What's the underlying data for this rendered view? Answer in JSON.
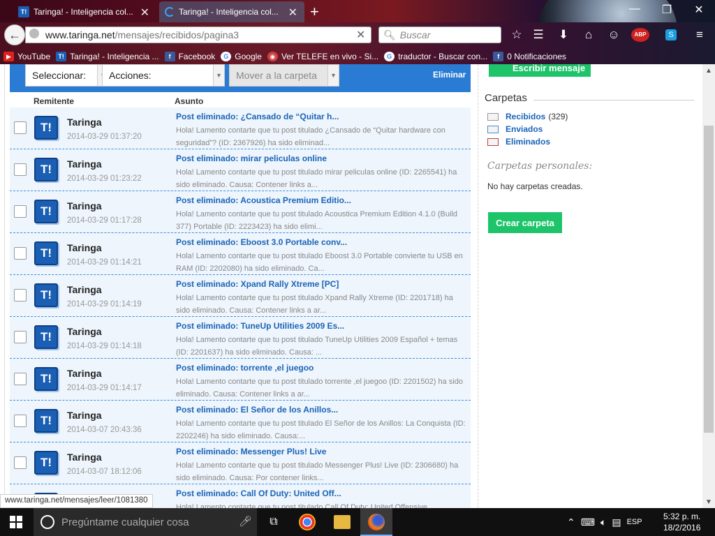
{
  "browser": {
    "tabs": [
      {
        "title": "Taringa! - Inteligencia col...",
        "favicon": "T!"
      },
      {
        "title": "Taringa! - Inteligencia col...",
        "favicon": "loading"
      }
    ],
    "url_domain": "www.taringa.net",
    "url_path": "/mensajes/recibidos/pagina3",
    "search_placeholder": "Buscar",
    "addon_label": "ABP",
    "bookmarks": [
      {
        "label": "YouTube",
        "icon": "youtube-icon",
        "color": "#e02020"
      },
      {
        "label": "Taringa! - Inteligencia ...",
        "icon": "T!",
        "color": "#1b5fb5"
      },
      {
        "label": "Facebook",
        "icon": "f",
        "color": "#3b5998"
      },
      {
        "label": "Google",
        "icon": "G",
        "color": "#ffffff"
      },
      {
        "label": "Ver TELEFE en vivo - Si...",
        "icon": "eye",
        "color": "#d04040"
      },
      {
        "label": "traductor - Buscar con...",
        "icon": "G",
        "color": "#ffffff"
      },
      {
        "label": "0 Notificaciones",
        "icon": "f",
        "color": "#3b5998"
      }
    ]
  },
  "toolbar": {
    "select_label": "Seleccionar:",
    "actions_label": "Acciones:",
    "move_label": "Mover a la carpeta",
    "delete_label": "Eliminar"
  },
  "columns": {
    "sender": "Remitente",
    "subject": "Asunto"
  },
  "messages": [
    {
      "sender": "Taringa",
      "date": "2014-03-29 01:37:20",
      "subject": "Post eliminado: ¿Cansado de “Quitar h...",
      "preview": "Hola! Lamento contarte que tu post titulado ¿Cansado de “Quitar hardware con seguridad”? (ID: 2367926) ha sido eliminad..."
    },
    {
      "sender": "Taringa",
      "date": "2014-03-29 01:23:22",
      "subject": "Post eliminado: mirar peliculas online",
      "preview": "Hola! Lamento contarte que tu post titulado mirar peliculas online (ID: 2265541) ha sido eliminado. Causa: Contener links a..."
    },
    {
      "sender": "Taringa",
      "date": "2014-03-29 01:17:28",
      "subject": "Post eliminado: Acoustica Premium Editio...",
      "preview": "Hola! Lamento contarte que tu post titulado Acoustica Premium Edition 4.1.0 (Build 377) Portable (ID: 2223423) ha sido elimi..."
    },
    {
      "sender": "Taringa",
      "date": "2014-03-29 01:14:21",
      "subject": "Post eliminado: Eboost 3.0 Portable conv...",
      "preview": "Hola! Lamento contarte que tu post titulado Eboost 3.0 Portable convierte tu USB en RAM (ID: 2202080) ha sido eliminado. Ca..."
    },
    {
      "sender": "Taringa",
      "date": "2014-03-29 01:14:19",
      "subject": "Post eliminado: Xpand Rally Xtreme [PC]",
      "preview": "Hola! Lamento contarte que tu post titulado Xpand Rally Xtreme (ID: 2201718) ha sido eliminado. Causa: Contener links a ar..."
    },
    {
      "sender": "Taringa",
      "date": "2014-03-29 01:14:18",
      "subject": "Post eliminado: TuneUp Utilities 2009 Es...",
      "preview": "Hola! Lamento contarte que tu post titulado TuneUp Utilities 2009 Español + temas (ID: 2201637) ha sido eliminado. Causa: ..."
    },
    {
      "sender": "Taringa",
      "date": "2014-03-29 01:14:17",
      "subject": "Post eliminado: torrente ,el juegoo",
      "preview": "Hola! Lamento contarte que tu post titulado torrente ,el juegoo (ID: 2201502) ha sido eliminado. Causa: Contener links a ar..."
    },
    {
      "sender": "Taringa",
      "date": "2014-03-07 20:43:36",
      "subject": "Post eliminado: El Señor de los Anillos...",
      "preview": "Hola! Lamento contarte que tu post titulado El Señor de los Anillos: La Conquista (ID: 2202246) ha sido eliminado. Causa:..."
    },
    {
      "sender": "Taringa",
      "date": "2014-03-07 18:12:06",
      "subject": "Post eliminado: Messenger Plus! Live",
      "preview": "Hola! Lamento contarte que tu post titulado Messenger Plus! Live (ID: 2306680) ha sido eliminado. Causa: Por contener links..."
    },
    {
      "sender": "Taringa",
      "date": "",
      "subject": "Post eliminado: Call Of Duty: United Off...",
      "preview": "Hola! Lamento contarte que tu post titulado Call Of Duty: United Offensive"
    }
  ],
  "sidebar": {
    "write_label": "Escribir mensaje",
    "folders_title": "Carpetas",
    "folders": [
      {
        "label": "Recibidos",
        "count": "(329)"
      },
      {
        "label": "Enviados",
        "count": ""
      },
      {
        "label": "Eliminados",
        "count": ""
      }
    ],
    "personal_title": "Carpetas personales:",
    "empty_text": "No hay carpetas creadas.",
    "create_label": "Crear carpeta"
  },
  "status_url": "www.taringa.net/mensajes/leer/1081380",
  "taskbar": {
    "search_placeholder": "Pregúntame cualquier cosa",
    "lang": "ESP",
    "time": "5:32 p. m.",
    "date": "18/2/2016"
  },
  "colors": {
    "accent": "#2a7bd3",
    "green": "#1ec46a",
    "link": "#1a64b8"
  }
}
